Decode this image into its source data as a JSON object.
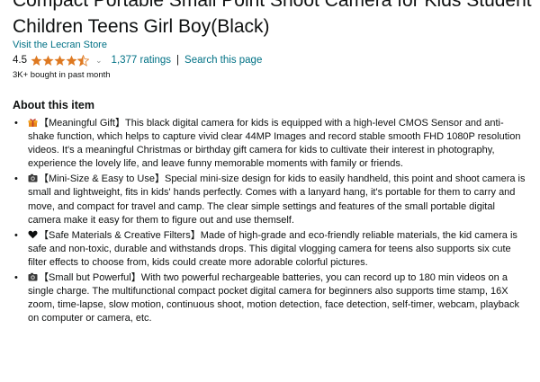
{
  "product": {
    "title": "Compact Portable Small Point Shoot Camera for Kids Student Children Teens Girl Boy(Black)",
    "store_link": "Visit the Lecran Store",
    "rating": "4.5",
    "stars_filled": 4.5,
    "ratings_count": "1,377 ratings",
    "separator": "|",
    "search_link": "Search this page",
    "bought": "3K+ bought in past month",
    "star_color": "#de7921"
  },
  "about": {
    "heading": "About this item",
    "bullets": [
      {
        "icon": "gift-icon",
        "text": "【Meaningful Gift】This black digital camera for kids is equipped with a high-level CMOS Sensor and anti-shake function, which helps to capture vivid clear 44MP Images and record stable smooth FHD 1080P resolution videos. It's a meaningful Christmas or birthday gift camera for kids to cultivate their interest in photography, experience the lovely life, and leave funny memorable moments with family or friends."
      },
      {
        "icon": "camera-icon",
        "text": "【Mini-Size & Easy to Use】Special mini-size design for kids to easily handheld, this point and shoot camera is small and lightweight, fits in kids' hands perfectly. Comes with a lanyard hang, it's portable for them to carry and move, and compact for travel and camp. The clear simple settings and features of the small portable digital camera make it easy for them to figure out and use themself."
      },
      {
        "icon": "heart-icon",
        "text": "【Safe Materials & Creative Filters】Made of high-grade and eco-friendly reliable materials, the kid camera is safe and non-toxic, durable and withstands drops. This digital vlogging camera for teens also supports six cute filter effects to choose from, kids could create more adorable colorful pictures."
      },
      {
        "icon": "camera-icon",
        "text": "【Small but Powerful】With two powerful rechargeable batteries, you can record up to 180 min videos on a single charge. The multifunctional compact pocket digital camera for beginners also supports time stamp, 16X zoom, time-lapse, slow motion, continuous shoot, motion detection, face detection, self-timer, webcam, playback on computer or camera, etc."
      }
    ]
  }
}
